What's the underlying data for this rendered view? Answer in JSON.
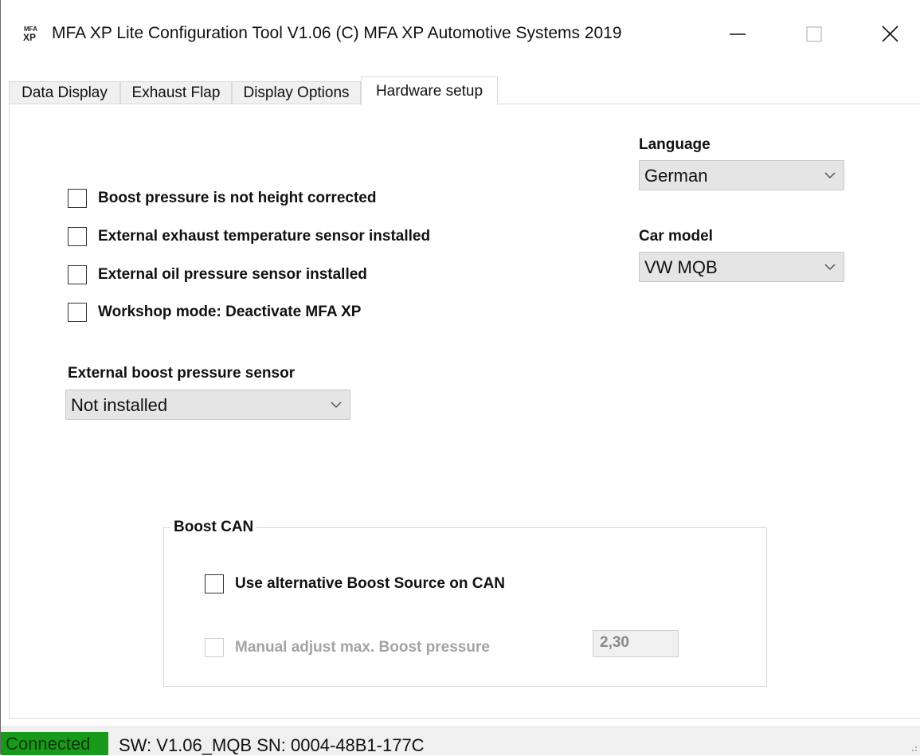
{
  "window": {
    "logo_text": "MFA XP",
    "title": "MFA XP Lite Configuration Tool V1.06  (C) MFA XP Automotive Systems 2019",
    "controls": [
      "minimize-icon",
      "maximize-icon",
      "close-icon"
    ]
  },
  "tabs": [
    {
      "label": "Data Display",
      "active": false
    },
    {
      "label": "Exhaust Flap",
      "active": false
    },
    {
      "label": "Display Options",
      "active": false
    },
    {
      "label": "Hardware setup",
      "active": true
    }
  ],
  "options": [
    {
      "label": "Boost pressure is not height corrected",
      "checked": false
    },
    {
      "label": "External exhaust temperature sensor installed",
      "checked": false
    },
    {
      "label": "External oil pressure sensor installed",
      "checked": false
    },
    {
      "label": "Workshop mode: Deactivate MFA XP",
      "checked": false
    }
  ],
  "language": {
    "label": "Language",
    "value": "German"
  },
  "car_model": {
    "label": "Car model",
    "value": "VW MQB"
  },
  "boost_sensor": {
    "label": "External boost pressure sensor",
    "value": "Not installed"
  },
  "boost_can": {
    "title": "Boost CAN",
    "use_alt_label": "Use alternative Boost Source on CAN",
    "use_alt_checked": false,
    "manual_adjust_label": "Manual adjust max. Boost pressure",
    "manual_adjust_enabled": false,
    "max_boost_value": "2,30"
  },
  "status": {
    "connection": "Connected",
    "info": "SW: V1.06_MQB   SN: 0004-48B1-177C",
    "connected_color": "#1a9a1a"
  }
}
